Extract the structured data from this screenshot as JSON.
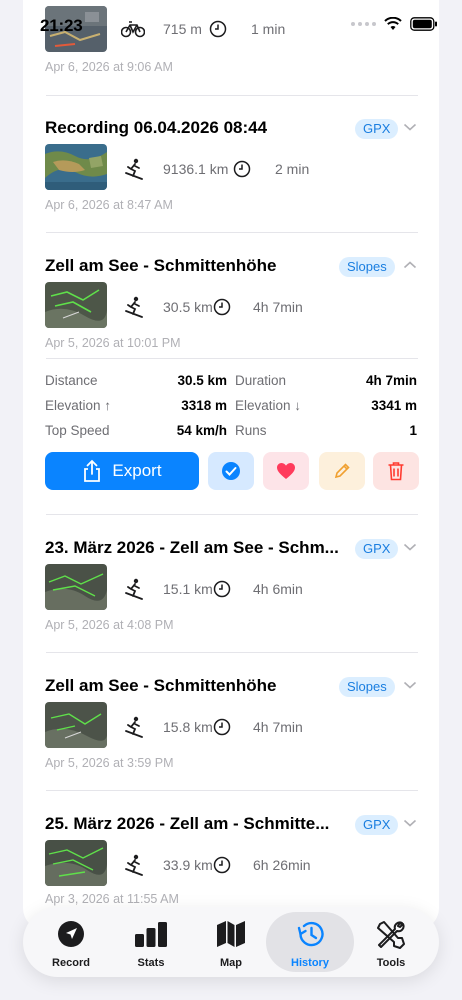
{
  "status_bar": {
    "time": "21:23"
  },
  "entries": [
    {
      "title": "",
      "badge": "",
      "distance": "715 m",
      "duration": "1 min",
      "date": "Apr 6, 2026 at 9:06 AM",
      "activity_icon": "bicycle-icon"
    },
    {
      "title": "Recording 06.04.2026 08:44",
      "badge": "GPX",
      "distance": "9136.1 km",
      "duration": "2 min",
      "date": "Apr 6, 2026 at 8:47 AM",
      "activity_icon": "skier-icon"
    },
    {
      "title": "Zell am See - Schmittenhöhe",
      "badge": "Slopes",
      "distance": "30.5 km",
      "duration": "4h 7min",
      "date": "Apr 5, 2026 at 10:01 PM",
      "activity_icon": "skier-icon",
      "expanded": true
    },
    {
      "title": "23. März 2026 - Zell am See - Schm...",
      "badge": "GPX",
      "distance": "15.1 km",
      "duration": "4h 6min",
      "date": "Apr 5, 2026 at 4:08 PM",
      "activity_icon": "skier-icon"
    },
    {
      "title": "Zell am See - Schmittenhöhe",
      "badge": "Slopes",
      "distance": "15.8 km",
      "duration": "4h 7min",
      "date": "Apr 5, 2026 at 3:59 PM",
      "activity_icon": "skier-icon"
    },
    {
      "title": "25. März 2026 - Zell am - Schmitte...",
      "badge": "GPX",
      "distance": "33.9 km",
      "duration": "6h 26min",
      "date": "Apr 3, 2026 at 11:55 AM",
      "activity_icon": "skier-icon"
    }
  ],
  "details": {
    "distance_label": "Distance",
    "distance_value": "30.5 km",
    "duration_label": "Duration",
    "duration_value": "4h 7min",
    "elev_up_label": "Elevation ↑",
    "elev_up_value": "3318 m",
    "elev_down_label": "Elevation ↓",
    "elev_down_value": "3341 m",
    "top_speed_label": "Top Speed",
    "top_speed_value": "54 km/h",
    "runs_label": "Runs",
    "runs_value": "1"
  },
  "actions": {
    "export_label": "Export"
  },
  "tabs": [
    {
      "label": "Record",
      "icon": "location-arrow-icon",
      "active": false
    },
    {
      "label": "Stats",
      "icon": "bar-chart-icon",
      "active": false
    },
    {
      "label": "Map",
      "icon": "map-icon",
      "active": false
    },
    {
      "label": "History",
      "icon": "history-clock-icon",
      "active": true
    },
    {
      "label": "Tools",
      "icon": "tools-icon",
      "active": false
    }
  ],
  "colors": {
    "accent": "#0a84ff",
    "badge_bg": "#dbeeff",
    "badge_text": "#1a7ee0",
    "favorite": "#ff3b5c",
    "edit": "#f0a030",
    "delete": "#ff3b30"
  }
}
